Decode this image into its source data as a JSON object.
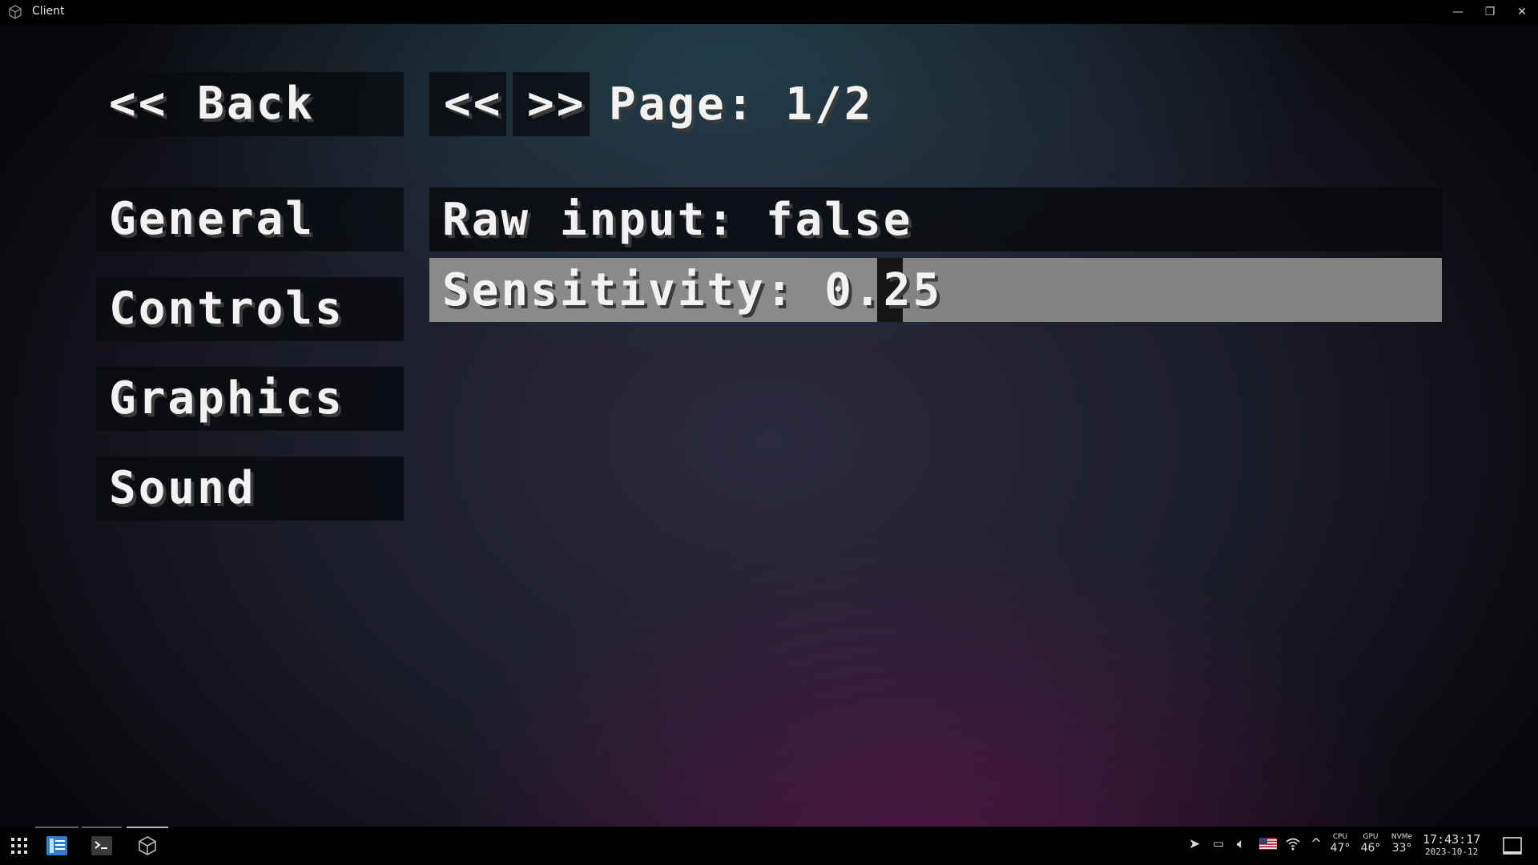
{
  "window": {
    "title": "Client",
    "controls": {
      "minimize": "—",
      "restore": "❐",
      "close": "✕"
    }
  },
  "nav": {
    "back_label": "<< Back",
    "prev_label": "<<",
    "next_label": ">>",
    "page_label": "Page: 1/2"
  },
  "categories": [
    {
      "label": "General"
    },
    {
      "label": "Controls"
    },
    {
      "label": "Graphics"
    },
    {
      "label": "Sound"
    }
  ],
  "options": {
    "raw_input_label": "Raw input: false",
    "sensitivity": {
      "label": "Sensitivity: 0.25",
      "value": 0.25,
      "min": 0,
      "max": 1
    }
  },
  "taskbar": {
    "sensors": [
      {
        "name": "CPU",
        "value": "47°"
      },
      {
        "name": "GPU",
        "value": "46°"
      },
      {
        "name": "NVMe",
        "value": "33°"
      }
    ],
    "time": "17:43:17",
    "date": "2023-10-12"
  }
}
